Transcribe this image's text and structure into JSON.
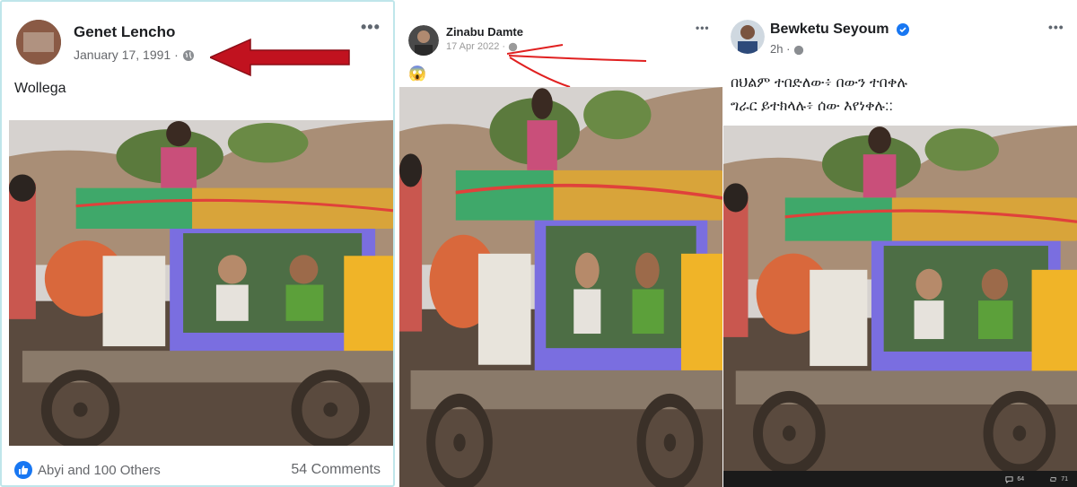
{
  "posts": [
    {
      "author": "Genet Lencho",
      "date": "January 17, 1991",
      "privacy_icon": "globe-icon",
      "caption": "Wollega",
      "reactions": "Abyi and 100 Others",
      "comments": "54 Comments",
      "annotation_arrow_color": "#c1121f"
    },
    {
      "author": "Zinabu Damte",
      "date": "17 Apr 2022",
      "privacy_icon": "globe-icon",
      "emoji": "😱",
      "annotation_color": "#e02020"
    },
    {
      "author": "Bewketu Seyoum",
      "date": "2h",
      "verified": true,
      "privacy_icon": "globe-icon",
      "caption_line1": "በህልም ተበድለው፥ በውን ተበቀሉ",
      "caption_line2": "ግራር ይተክላሉ፥ ሰው እየነቀሉ::",
      "footer_comments": "64",
      "footer_shares": "71"
    }
  ],
  "colors": {
    "accent": "#1877f2",
    "muted_text": "#65676b",
    "panel_border": "#bfe6ea"
  }
}
